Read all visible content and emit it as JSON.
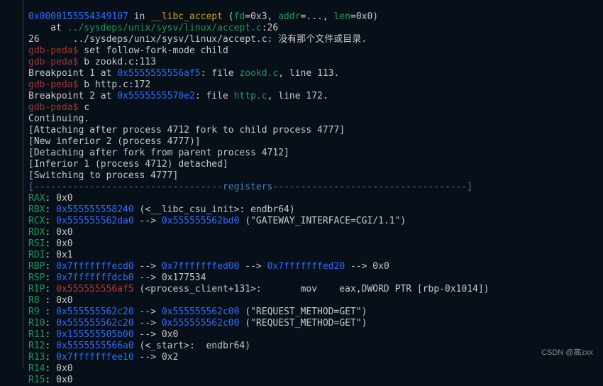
{
  "l00_addr": "0x0000155554349107",
  "l00_in": " in ",
  "l00_fn": "__libc_accept",
  "l00_args": " (",
  "l00_fd": "fd",
  "l00_after_fd": "=0x3, ",
  "l00_addr2": "addr",
  "l00_after_addr": "=..., ",
  "l00_len": "len",
  "l00_after_len": "=0x0)",
  "l01_at": "    at ",
  "l01_src": "../sysdeps/unix/sysv/linux/accept.c",
  "l01_tail": ":26",
  "l02": "26      ../sysdeps/unix/sysv/linux/accept.c: 没有那个文件或目录.",
  "p0": "gdb-peda$",
  "c0": " set follow-fork-mode child",
  "p1": "gdb-peda$",
  "c1": " b zookd.c:113",
  "bp1_a": "Breakpoint 1 at ",
  "bp1_addr": "0x5555555556af5",
  "bp1_b": ": file ",
  "bp1_file": "zookd.c",
  "bp1_c": ", line 113.",
  "p2": "gdb-peda$",
  "c2": " b http.c:172",
  "bp2_a": "Breakpoint 2 at ",
  "bp2_addr": "0x5555555570e2",
  "bp2_b": ": file ",
  "bp2_file": "http.c",
  "bp2_c": ", line 172.",
  "p3": "gdb-peda$",
  "c3": " c",
  "cont": "Continuing.",
  "att": "[Attaching after process 4712 fork to child process 4777]",
  "newinf": "[New inferior 2 (process 4777)]",
  "det": "[Detaching after fork from parent process 4712]",
  "inf1": "[Inferior 1 (process 4712) detached]",
  "sw": "[Switching to process 4777]",
  "reghdr": "[----------------------------------registers-----------------------------------]",
  "rax_n": "RAX",
  "rax_v": ": 0x0",
  "rbx_n": "RBX",
  "rbx_sep": ": ",
  "rbx_a": "0x555555558240",
  "rbx_ann": " (<__libc_csu_init>: endbr64)",
  "rcx_n": "RCX",
  "rcx_sep": ": ",
  "rcx_a": "0x555555562da0",
  "rcx_arrow": " --> ",
  "rcx_b": "0x555555562bd0",
  "rcx_ann": " (\"GATEWAY_INTERFACE=CGI/1.1\")",
  "rdx_n": "RDX",
  "rdx_v": ": 0x0",
  "rsi_n": "RSI",
  "rsi_v": ": 0x0",
  "rdi_n": "RDI",
  "rdi_v": ": 0x1",
  "rbp_n": "RBP",
  "rbp_sep": ": ",
  "rbp_a": "0x7fffffffecd0",
  "rbp_ar1": " --> ",
  "rbp_b": "0x7fffffffed00",
  "rbp_ar2": " --> ",
  "rbp_c": "0x7fffffffed20",
  "rbp_ar3": " --> 0x0",
  "rsp_n": "RSP",
  "rsp_sep": ": ",
  "rsp_a": "0x7fffffffdcb0",
  "rsp_t": " --> 0x177534",
  "rip_n": "RIP",
  "rip_sep": ": ",
  "rip_a": "0x555555556af5",
  "rip_t": " (<process_client+131>:       mov    eax,DWORD PTR [rbp-0x1014])",
  "r8_n": "R8 ",
  "r8_v": ": 0x0",
  "r9_n": "R9 ",
  "r9_sep": ": ",
  "r9_a": "0x555555562c20",
  "r9_ar": " --> ",
  "r9_b": "0x555555562c00",
  "r9_ann": " (\"REQUEST_METHOD=GET\")",
  "r10_n": "R10",
  "r10_sep": ": ",
  "r10_a": "0x555555562c20",
  "r10_ar": " --> ",
  "r10_b": "0x555555562c00",
  "r10_ann": " (\"REQUEST_METHOD=GET\")",
  "r11_n": "R11",
  "r11_sep": ": ",
  "r11_a": "0x155555505b00",
  "r11_t": " --> 0x0",
  "r12_n": "R12",
  "r12_sep": ": ",
  "r12_a": "0x5555555566a0",
  "r12_t": " (<_start>:  endbr64)",
  "r13_n": "R13",
  "r13_sep": ": ",
  "r13_a": "0x7fffffffee10",
  "r13_t": " --> 0x2",
  "r14_n": "R14",
  "r14_v": ": 0x0",
  "r15_n": "R15",
  "r15_v": ": 0x0",
  "wm": "CSDN @高zxx"
}
